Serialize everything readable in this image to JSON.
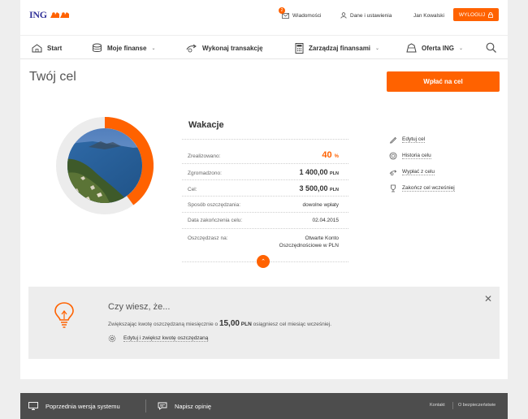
{
  "brand": {
    "logo_text": "ING",
    "accent": "#ff6200",
    "brand_blue": "#333399"
  },
  "topbar": {
    "messages_label": "Wiadomości",
    "messages_count": "2",
    "settings_label": "Dane i ustawienia",
    "user_name": "Jan Kowalski",
    "logout_label": "WYLOGUJ"
  },
  "nav": {
    "items": [
      {
        "label": "Start",
        "icon": "home-icon"
      },
      {
        "label": "Moje finanse",
        "icon": "coins-icon"
      },
      {
        "label": "Wykonaj transakcję",
        "icon": "transfer-icon"
      },
      {
        "label": "Zarządzaj finansami",
        "icon": "calculator-icon"
      },
      {
        "label": "Oferta ING",
        "icon": "offer-icon"
      }
    ]
  },
  "page": {
    "title": "Twój cel",
    "pay_button": "Wpłać na cel"
  },
  "goal": {
    "name": "Wakacje",
    "progress_fraction": 0.4,
    "rows": {
      "realized_label": "Zrealizowano:",
      "realized_value": "40",
      "realized_unit": "%",
      "collected_label": "Zgromadzono:",
      "collected_value": "1 400,00",
      "collected_unit": "PLN",
      "target_label": "Cel:",
      "target_value": "3 500,00",
      "target_unit": "PLN",
      "method_label": "Sposób oszczędzania:",
      "method_value": "dowolne wpłaty",
      "enddate_label": "Data zakończenia celu:",
      "enddate_value": "02.04.2015",
      "saving_in_label": "Oszczędzasz na:",
      "saving_in_line1": "Otwarte Konto",
      "saving_in_line2": "Oszczędnościowe w PLN"
    }
  },
  "actions": [
    {
      "label": "Edytuj cel",
      "icon": "pencil-icon"
    },
    {
      "label": "Historia celu",
      "icon": "history-icon"
    },
    {
      "label": "Wypłać z celu",
      "icon": "withdraw-icon"
    },
    {
      "label": "Zakończ cel wcześniej",
      "icon": "trophy-icon"
    }
  ],
  "tip": {
    "title": "Czy wiesz, że...",
    "text_before": "Zwiększając kwotę oszczędzaną miesięcznie o",
    "amount": "15,00",
    "amount_unit": "PLN",
    "text_after": "osiągniesz cel miesiąc wcześniej.",
    "link": "Edytuj i zwiększ kwotę oszczędzaną"
  },
  "footer": {
    "previous_version": "Poprzednia wersja systemu",
    "feedback": "Napisz opinię",
    "contact": "Kontakt",
    "security": "O bezpieczeństwie"
  }
}
